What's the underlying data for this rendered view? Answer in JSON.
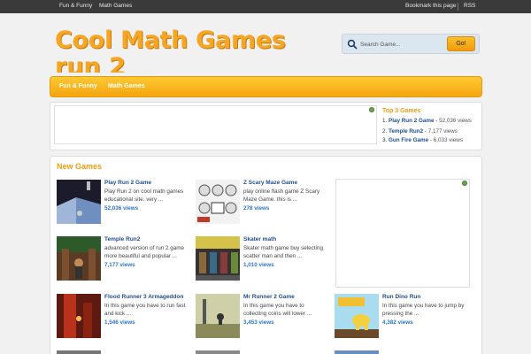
{
  "topbar": {
    "left_links": [
      "Fun & Funny",
      "Math Games"
    ],
    "right_links": [
      "Bookmark this page",
      "RSS"
    ]
  },
  "site": {
    "logo_line1": "Cool Math Games",
    "logo_line2": "run 2"
  },
  "search": {
    "placeholder": "Search Game...",
    "button_label": "Go!"
  },
  "nav": {
    "items": [
      "Fun & Funny",
      "Math Games"
    ]
  },
  "top_games": {
    "title": "Top 3 Games",
    "items": [
      {
        "num": "1.",
        "title": "Play Run 2 Game",
        "views": " - 52,036 views"
      },
      {
        "num": "2.",
        "title": "Temple Run2",
        "views": " - 7,177 views"
      },
      {
        "num": "3.",
        "title": "Gun Fire Game",
        "views": " - 6,033 views"
      }
    ]
  },
  "new_games": {
    "title": "New Games",
    "items": [
      {
        "title": "Play Run 2 Game",
        "desc": "Play Run 2 on cool math games educational site. very ...",
        "views": "52,036 views"
      },
      {
        "title": "Z Scary Maze Game",
        "desc": "play online flash game Z Scary Maze Game. this is ...",
        "views": "278 views"
      },
      {
        "title": "Temple Run2",
        "desc": "advanced version of run 2 game more beautiful and popular ...",
        "views": "7,177 views"
      },
      {
        "title": "Skater math",
        "desc": "Skater math game buy selecting scatter man and then ...",
        "views": "1,010 views"
      },
      {
        "title": "Flood Runner 3 Armageddon",
        "desc": "In this game you have to run fast and kick ...",
        "views": "1,546 views"
      },
      {
        "title": "Mr Runner 2 Game",
        "desc": "In this game you have to collecting  coins  will lower ...",
        "views": "3,453 views"
      },
      {
        "title": "Run Dino Run",
        "desc": "In this game you have to jump by pressing the ...",
        "views": "4,382 views"
      }
    ]
  },
  "colors": {
    "accent_orange": "#f39c12",
    "link_blue": "#1f4e8a",
    "views_blue": "#2a75c7",
    "topbar_bg": "#3a3a3a"
  }
}
